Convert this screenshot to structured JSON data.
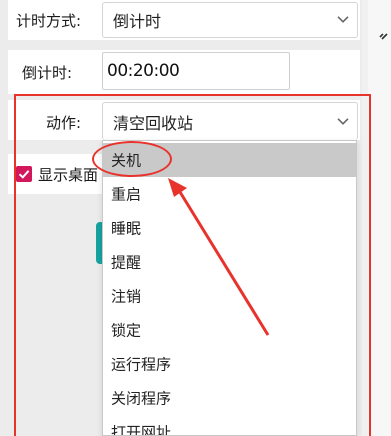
{
  "timing": {
    "mode_label": "计时方式:",
    "mode_value": "倒计时",
    "countdown_label": "倒计时:",
    "countdown_value": "00:20:00"
  },
  "action": {
    "label": "动作:",
    "selected_value": "清空回收站",
    "options": [
      {
        "label": "关机",
        "highlighted": true
      },
      {
        "label": "重启"
      },
      {
        "label": "睡眠"
      },
      {
        "label": "提醒"
      },
      {
        "label": "注销"
      },
      {
        "label": "锁定"
      },
      {
        "label": "运行程序"
      },
      {
        "label": "关闭程序"
      },
      {
        "label": "打开网址"
      }
    ]
  },
  "show_desktop": {
    "label": "显示桌面",
    "checked": true
  },
  "colors": {
    "annotation_red": "#e8332c",
    "checkbox_accent": "#d2185a",
    "teal_accent": "#17a3a0"
  }
}
